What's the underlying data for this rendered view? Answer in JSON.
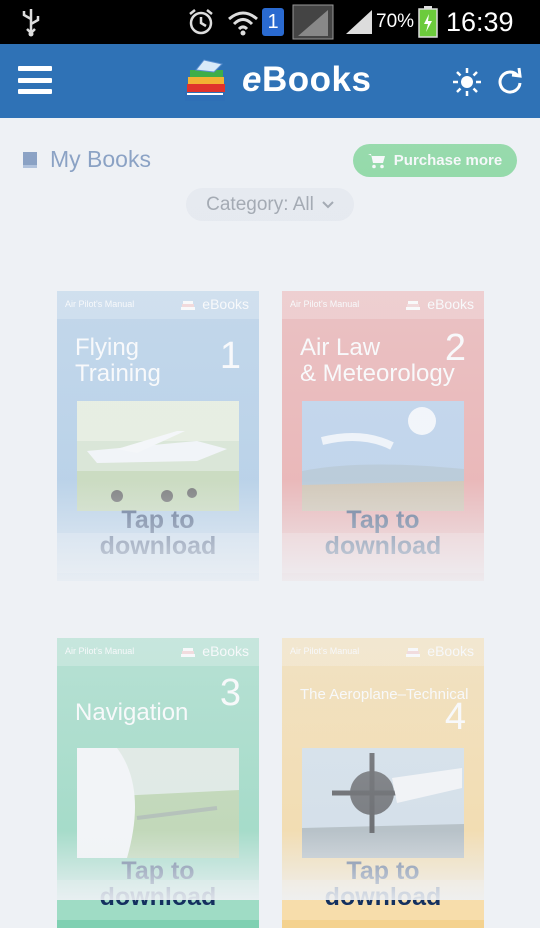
{
  "status_bar": {
    "time": "16:39",
    "battery": "70%",
    "wifi_badge": "1",
    "icons": [
      "usb-icon",
      "alarm-icon",
      "wifi-icon",
      "signal-icon",
      "battery-icon"
    ]
  },
  "app_bar": {
    "title_italic": "e",
    "title_rest": "Books",
    "icons": [
      "menu-icon",
      "books-logo-icon",
      "brightness-icon",
      "refresh-icon"
    ]
  },
  "toolbar": {
    "my_books_label": "My Books",
    "purchase_label": "Purchase more",
    "category_label": "Category: All"
  },
  "books": [
    {
      "series": "Air Pilot's Manual",
      "ebooks": "eBooks",
      "title": "Flying\nTraining",
      "number": "1",
      "tap_text": "Tap to\ndownload",
      "color": "#9fc2e2"
    },
    {
      "series": "Air Pilot's Manual",
      "ebooks": "eBooks",
      "title": "Air Law\n& Meteorology",
      "number": "2",
      "tap_text": "Tap to\ndownload",
      "color": "#e79a9a"
    },
    {
      "series": "Air Pilot's Manual",
      "ebooks": "eBooks",
      "title": "Navigation",
      "number": "3",
      "tap_text": "Tap to\ndownload",
      "color": "#7fd0b2"
    },
    {
      "series": "Air Pilot's Manual",
      "ebooks": "eBooks",
      "title": "The Aeroplane–Technical",
      "number": "4",
      "tap_text": "Tap to\ndownload",
      "color": "#f4d28f"
    }
  ],
  "colors": {
    "app_bar": "#2f72b6",
    "purchase_button": "#35c15a",
    "accent_text": "#1d4b8f"
  }
}
